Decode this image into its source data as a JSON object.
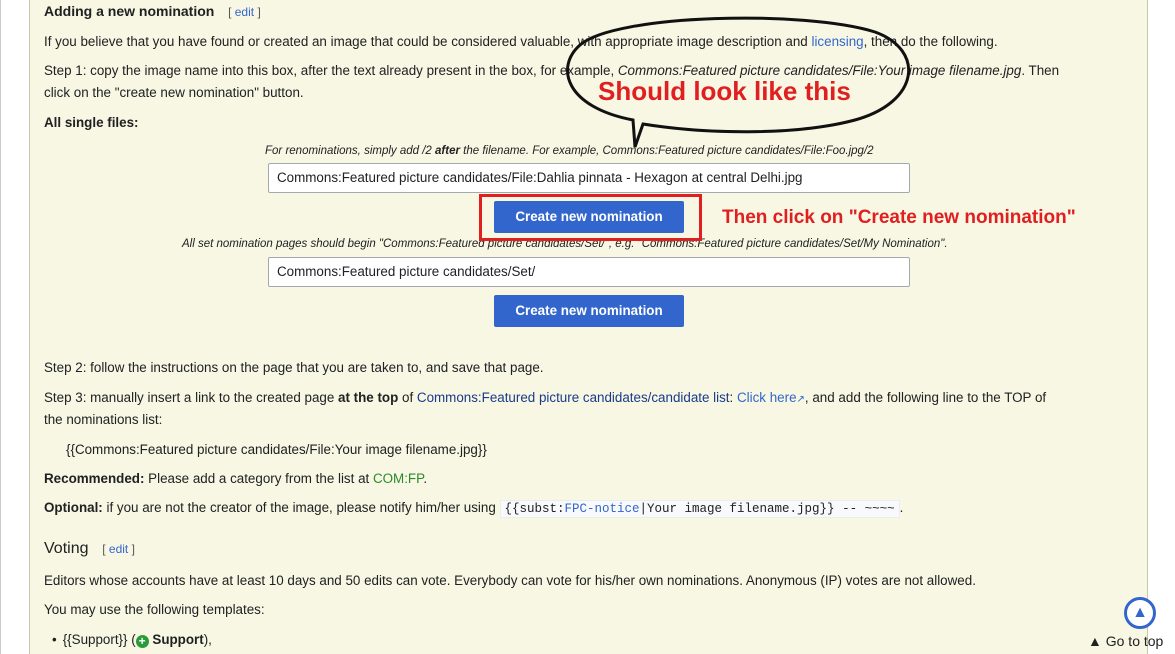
{
  "section1": {
    "heading": "Adding a new nomination",
    "edit_open": "[",
    "edit_label": "edit",
    "edit_close": "]",
    "intro_pre": "If you believe that you have found or created an image that could be considered valuable, with appropriate image description and ",
    "intro_link": "licensing",
    "intro_post": ", then do the following.",
    "step1_a": "Step 1: copy the image name into this box, after the text already present in the box, for example, ",
    "step1_example": "Commons:Featured picture candidates/File:Your image filename.jpg",
    "step1_b": ". Then",
    "step1_c": "click on the \"create new nomination\" button.",
    "all_single_files": "All single files:",
    "renom_pre": "For renominations, simply add /2 ",
    "renom_bold": "after",
    "renom_post": " the filename. For example, Commons:Featured picture candidates/File:Foo.jpg/2",
    "input1_value": "Commons:Featured picture candidates/File:Dahlia pinnata - Hexagon at central Delhi.jpg",
    "button1_label": "Create new nomination",
    "set_note": "All set nomination pages should begin \"Commons:Featured picture candidates/Set/\", e.g. \"Commons:Featured picture candidates/Set/My Nomination\".",
    "input2_value": "Commons:Featured picture candidates/Set/",
    "button2_label": "Create new nomination",
    "step2": "Step 2: follow the instructions on the page that you are taken to, and save that page.",
    "step3_pre": "Step 3: manually insert a link to the created page ",
    "step3_bold": "at the top",
    "step3_of": " of ",
    "step3_link": "Commons:Featured picture candidates/candidate list",
    "step3_colon": ": ",
    "step3_clickhere": "Click here",
    "step3_post": ", and add the following line to the TOP of",
    "step3_line2": "the nominations list:",
    "template_line": "{{Commons:Featured picture candidates/File:Your image filename.jpg}}",
    "recommended_label": "Recommended:",
    "recommended_text": " Please add a category from the list at ",
    "recommended_link": "COM:FP",
    "recommended_end": ".",
    "optional_label": "Optional:",
    "optional_text": " if you are not the creator of the image, please notify him/her using ",
    "code_pre": "{{subst:",
    "code_link": "FPC-notice",
    "code_post": "|Your image filename.jpg}} -- ~~~~",
    "optional_end": "."
  },
  "voting": {
    "heading": "Voting",
    "edit_open": "[",
    "edit_label": "edit",
    "edit_close": "]",
    "para1": "Editors whose accounts have at least 10 days and 50 edits can vote. Everybody can vote for his/her own nominations. Anonymous (IP) votes are not allowed.",
    "para2": "You may use the following templates:",
    "bullet1_pre": "{{Support}} (",
    "bullet1_icon": "+",
    "bullet1_bold": " Support",
    "bullet1_post": "),"
  },
  "annotations": {
    "bubble_text": "Should look like this",
    "click_text": "Then click on \"Create new nomination\"",
    "color": "#e02020"
  },
  "gotop": {
    "label": "▲ Go to top",
    "icon": "▲"
  },
  "colors": {
    "panel": "#f7f7e4",
    "button": "#3366cc",
    "link": "#3366cc"
  }
}
